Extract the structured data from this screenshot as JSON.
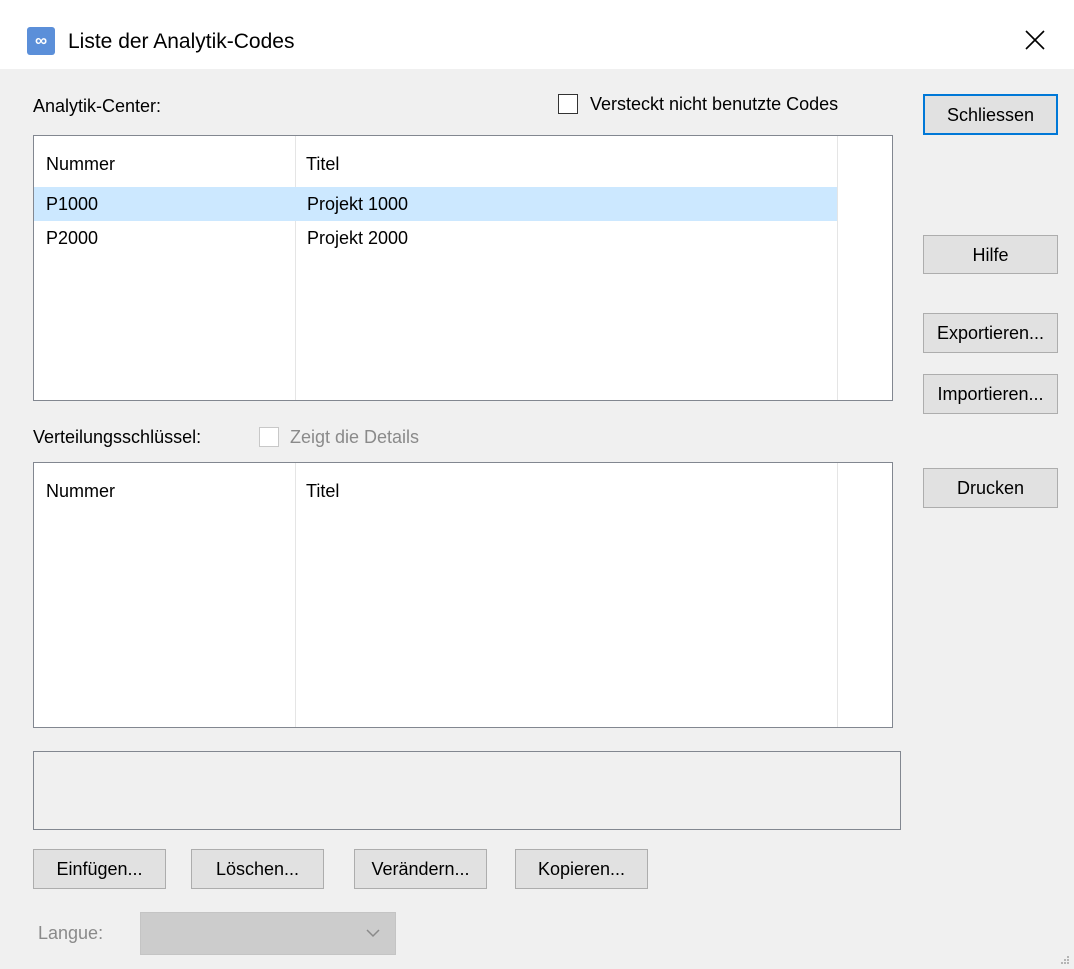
{
  "window": {
    "title": "Liste der Analytik-Codes",
    "icon": "app-logo-icon",
    "close_icon": "close-icon"
  },
  "analytik_center": {
    "label": "Analytik-Center:",
    "hide_unused_label": "Versteckt nicht benutzte Codes",
    "hide_unused_checked": false,
    "columns": [
      "Nummer",
      "Titel"
    ],
    "rows": [
      {
        "nummer": "P1000",
        "titel": "Projekt 1000",
        "selected": true
      },
      {
        "nummer": "P2000",
        "titel": "Projekt 2000",
        "selected": false
      }
    ]
  },
  "verteilung": {
    "label": "Verteilungsschlüssel:",
    "details_label": "Zeigt die Details",
    "details_checked": false,
    "details_enabled": false,
    "columns": [
      "Nummer",
      "Titel"
    ],
    "rows": []
  },
  "side_buttons": {
    "close": "Schliessen",
    "help": "Hilfe",
    "export": "Exportieren...",
    "import": "Importieren...",
    "print": "Drucken"
  },
  "bottom_buttons": {
    "insert": "Einfügen...",
    "delete": "Löschen...",
    "modify": "Verändern...",
    "copy": "Kopieren..."
  },
  "language": {
    "label": "Langue:",
    "value": "",
    "enabled": false
  },
  "colors": {
    "selection": "#cce8ff",
    "default_button_border": "#0078d7",
    "disabled_text": "#8a8a8a"
  }
}
